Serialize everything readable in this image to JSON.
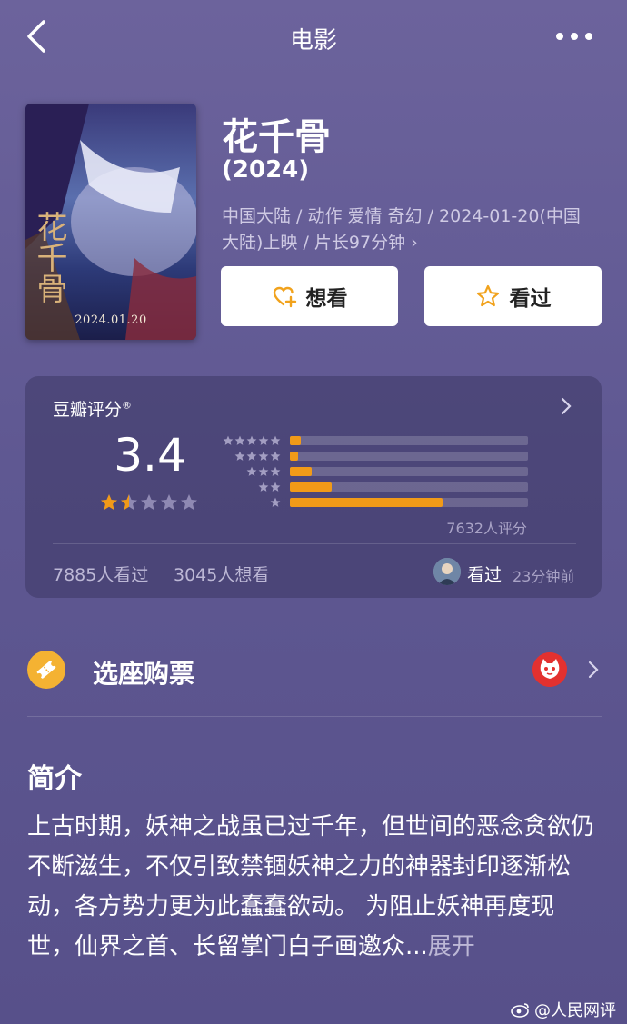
{
  "nav": {
    "title": "电影",
    "back_icon": "chevron-left-icon",
    "more_icon": "more-icon"
  },
  "movie": {
    "title": "花千骨",
    "year": "(2024)",
    "meta": "中国大陆 / 动作 爱情 奇幻 / 2024-01-20(中国大陆)上映 / 片长97分钟 ›",
    "poster_date": "2024.01.20",
    "poster_calligraphy": "花千骨"
  },
  "actions": {
    "want_label": "想看",
    "seen_label": "看过"
  },
  "rating": {
    "title": "豆瓣评分",
    "reg": "®",
    "score": "3.4",
    "star_value": 1.5,
    "distribution": [
      {
        "stars": 5,
        "percent": 4.5
      },
      {
        "stars": 4,
        "percent": 3.5
      },
      {
        "stars": 3,
        "percent": 9
      },
      {
        "stars": 2,
        "percent": 17.5
      },
      {
        "stars": 1,
        "percent": 64
      }
    ],
    "raters": "7632人评分",
    "watched": "7885人看过",
    "wanted": "3045人想看",
    "friend_action": "看过",
    "friend_time": "23分钟前",
    "accent": "#f19a18"
  },
  "ticket": {
    "label": "选座购票"
  },
  "synopsis": {
    "heading": "简介",
    "text": "上古时期，妖神之战虽已过千年，但世间的恶念贪欲仍不断滋生，不仅引致禁锢妖神之力的神器封印逐渐松动，各方势力更为此蠢蠢欲动。 为阻止妖神再度现世，仙界之首、长留掌门白子画邀众...",
    "expand": "展开"
  },
  "watermark": "@人民网评"
}
